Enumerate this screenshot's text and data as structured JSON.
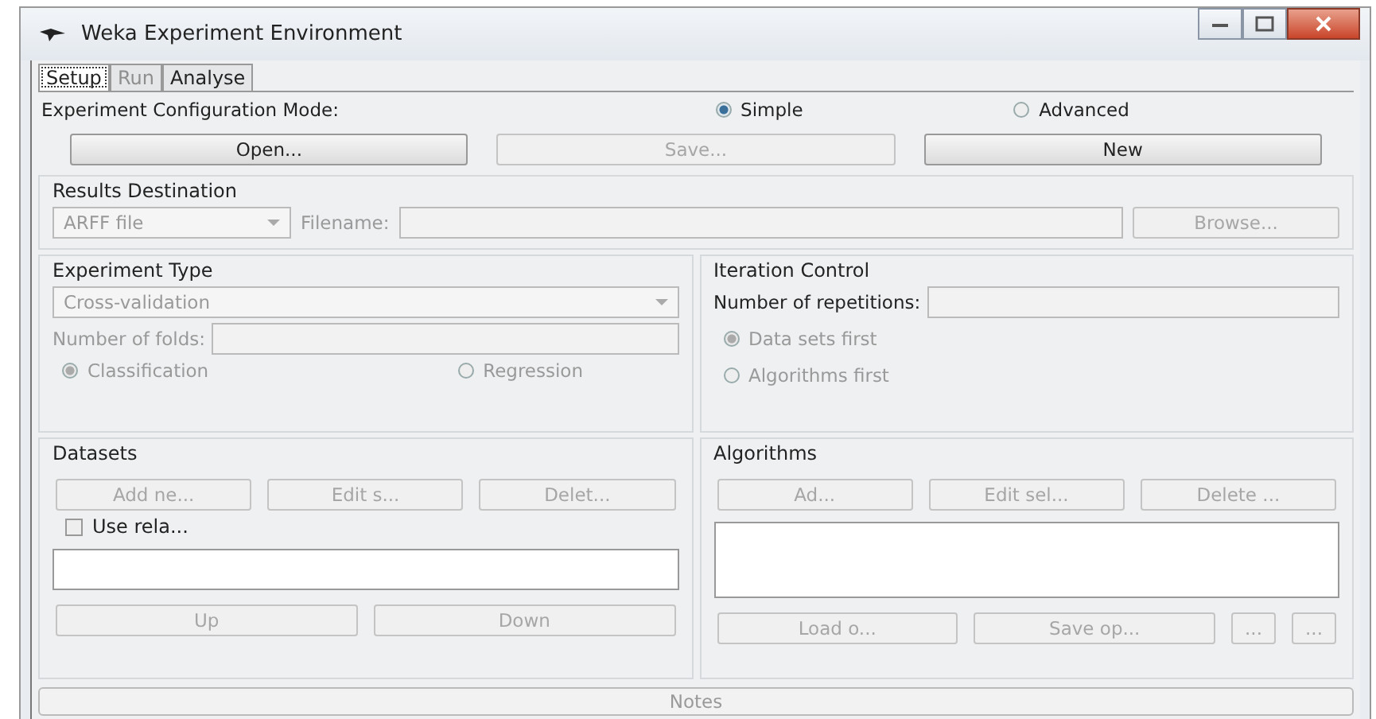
{
  "window": {
    "title": "Weka Experiment Environment"
  },
  "tabs": [
    {
      "label": "Setup",
      "selected": true,
      "disabled": false
    },
    {
      "label": "Run",
      "selected": false,
      "disabled": true
    },
    {
      "label": "Analyse",
      "selected": false,
      "disabled": false
    }
  ],
  "config_mode": {
    "label": "Experiment Configuration Mode:",
    "options": [
      {
        "label": "Simple",
        "selected": true
      },
      {
        "label": "Advanced",
        "selected": false
      }
    ]
  },
  "file_buttons": [
    {
      "label": "Open...",
      "disabled": false
    },
    {
      "label": "Save...",
      "disabled": true
    },
    {
      "label": "New",
      "disabled": false
    }
  ],
  "results_destination": {
    "title": "Results Destination",
    "format": "ARFF file",
    "filename_label": "Filename:",
    "browse": "Browse..."
  },
  "experiment_type": {
    "title": "Experiment Type",
    "type": "Cross-validation",
    "folds_label": "Number of folds:",
    "options": [
      {
        "label": "Classification",
        "selected": true
      },
      {
        "label": "Regression",
        "selected": false
      }
    ]
  },
  "iteration_control": {
    "title": "Iteration Control",
    "repetitions_label": "Number of repetitions:",
    "options": [
      {
        "label": "Data sets first",
        "selected": true
      },
      {
        "label": "Algorithms first",
        "selected": false
      }
    ]
  },
  "datasets": {
    "title": "Datasets",
    "buttons": [
      "Add ne...",
      "Edit s...",
      "Delet..."
    ],
    "checkbox": {
      "label": "Use rela...",
      "checked": false
    },
    "bottom_buttons": [
      "Up",
      "Down"
    ]
  },
  "algorithms": {
    "title": "Algorithms",
    "buttons": [
      "Ad...",
      "Edit sel...",
      "Delete ..."
    ],
    "bottom_buttons": [
      "Load o...",
      "Save op...",
      "...",
      "..."
    ]
  },
  "notes": "Notes"
}
